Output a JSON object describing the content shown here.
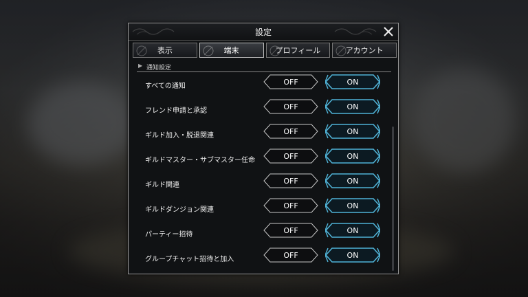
{
  "dialog": {
    "title": "設定",
    "close_icon": "close-icon"
  },
  "tabs": [
    {
      "label": "表示",
      "active": false
    },
    {
      "label": "端末",
      "active": true
    },
    {
      "label": "プロフィール",
      "active": false
    },
    {
      "label": "アカウント",
      "active": false
    }
  ],
  "section": {
    "label": "通知設定"
  },
  "toggle_labels": {
    "off": "OFF",
    "on": "ON"
  },
  "rows": [
    {
      "label": "すべての通知",
      "value": "ON"
    },
    {
      "label": "フレンド申請と承認",
      "value": "ON"
    },
    {
      "label": "ギルド加入・脱退関連",
      "value": "ON"
    },
    {
      "label": "ギルドマスター・サブマスター任命",
      "value": "ON"
    },
    {
      "label": "ギルド関連",
      "value": "ON"
    },
    {
      "label": "ギルドダンジョン関連",
      "value": "ON"
    },
    {
      "label": "パーティー招待",
      "value": "ON"
    },
    {
      "label": "グループチャット招待と加入",
      "value": "ON"
    }
  ],
  "colors": {
    "on_border": "#4fb2d6",
    "off_border": "#c8c8c8",
    "panel_bg": "#101214"
  }
}
